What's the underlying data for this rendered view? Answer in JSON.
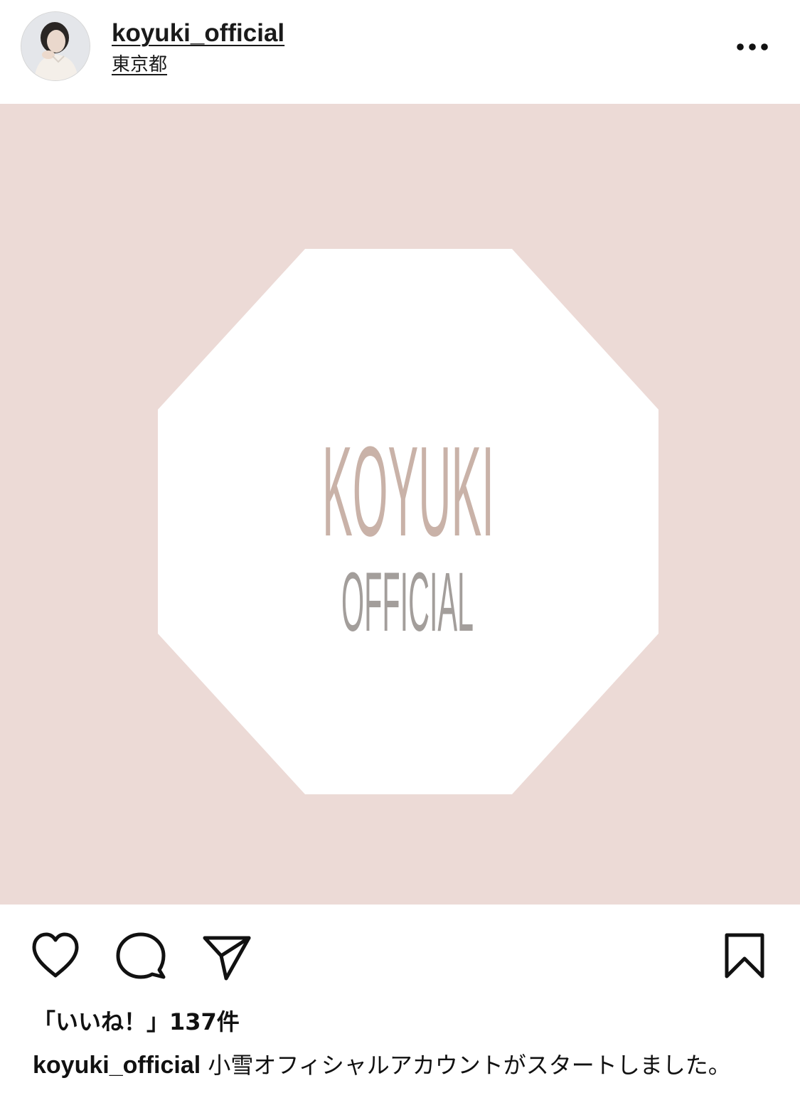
{
  "header": {
    "username": "koyuki_official",
    "location": "東京都",
    "more_icon": "more-horizontal-icon"
  },
  "image": {
    "logo_line1": "KOYUKI",
    "logo_line2": "OFFICIAL",
    "colors": {
      "background": "#ecdad6",
      "octagon": "#ffffff",
      "logo_line1": "#c9b2a8",
      "logo_line2": "#a39e9b"
    }
  },
  "actions": {
    "like_icon": "heart-icon",
    "comment_icon": "comment-icon",
    "share_icon": "paper-plane-icon",
    "save_icon": "bookmark-icon"
  },
  "likes": {
    "text": "「いいね！」137件"
  },
  "caption": {
    "username": "koyuki_official",
    "text": "小雪オフィシャルアカウントがスタートしました。"
  }
}
